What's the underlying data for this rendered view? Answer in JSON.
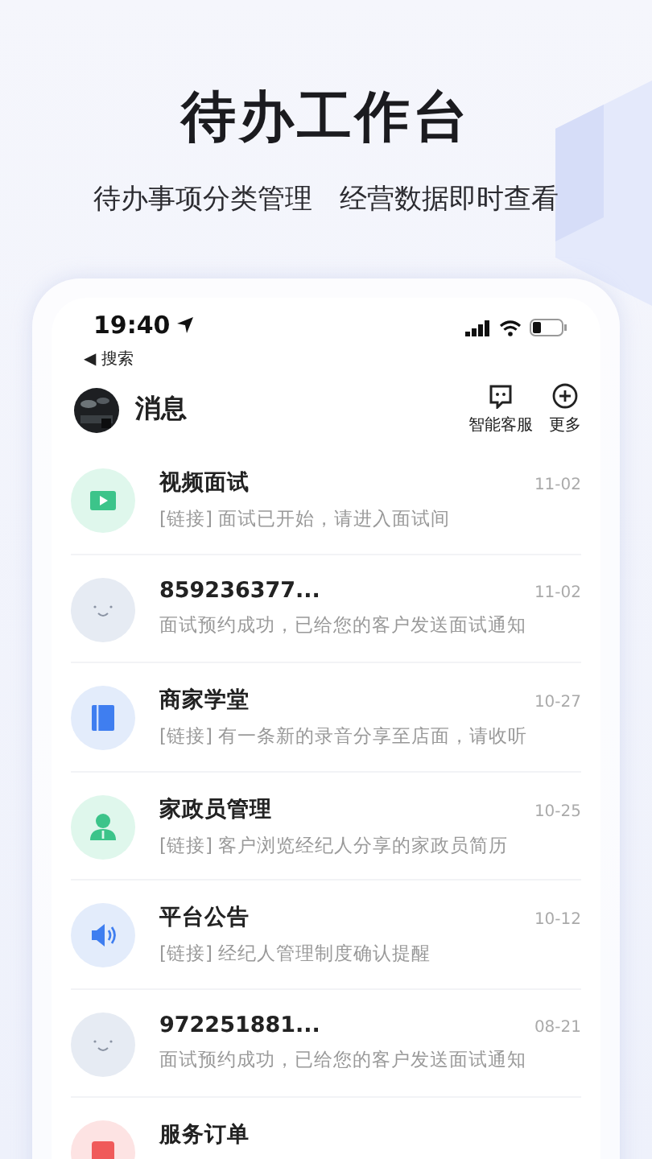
{
  "headline": "待办工作台",
  "subtitle": "待办事项分类管理　经营数据即时查看",
  "status_bar": {
    "time": "19:40",
    "back_label": "◀ 搜索"
  },
  "header": {
    "title": "消息",
    "actions": [
      {
        "kind": "service",
        "label": "智能客服"
      },
      {
        "kind": "more",
        "label": "更多"
      }
    ]
  },
  "messages": [
    {
      "kind": "video",
      "title": "视频面试",
      "preview": "[链接] 面试已开始，请进入面试间",
      "date": "11-02"
    },
    {
      "kind": "smile",
      "title": "859236377...",
      "preview": "面试预约成功，已给您的客户发送面试通知",
      "date": "11-02"
    },
    {
      "kind": "book",
      "title": "商家学堂",
      "preview": "[链接] 有一条新的录音分享至店面，请收听",
      "date": "10-27"
    },
    {
      "kind": "person",
      "title": "家政员管理",
      "preview": "[链接] 客户浏览经纪人分享的家政员简历",
      "date": "10-25"
    },
    {
      "kind": "speaker",
      "title": "平台公告",
      "preview": "[链接] 经纪人管理制度确认提醒",
      "date": "10-12"
    },
    {
      "kind": "smile",
      "title": "972251881...",
      "preview": "面试预约成功，已给您的客户发送面试通知",
      "date": "08-21"
    },
    {
      "kind": "order",
      "title": "服务订单"
    }
  ]
}
